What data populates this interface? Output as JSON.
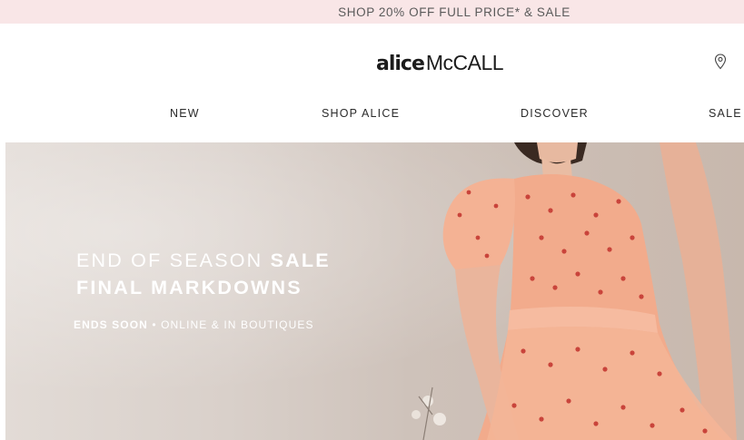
{
  "announcement": {
    "text": "SHOP 20% OFF FULL PRICE* & SALE"
  },
  "brand": {
    "logo_part1": "alice",
    "logo_part2": "McCALL"
  },
  "header": {
    "store_locator_icon": "map-pin-icon"
  },
  "nav": {
    "items": [
      {
        "label": "NEW"
      },
      {
        "label": "SHOP ALICE"
      },
      {
        "label": "DISCOVER"
      },
      {
        "label": "SALE"
      }
    ]
  },
  "hero": {
    "line1_regular": "END OF SEASON ",
    "line1_bold": "SALE",
    "line2": "FINAL MARKDOWNS",
    "line3_bold": "ENDS SOON",
    "line3_sep": " • ",
    "line3_regular": "ONLINE & IN BOUTIQUES"
  },
  "colors": {
    "announcement_bg": "#f9e6e7",
    "text_dark": "#2b2b2b",
    "hero_text": "#ffffff",
    "dress": "#f0a88a"
  }
}
